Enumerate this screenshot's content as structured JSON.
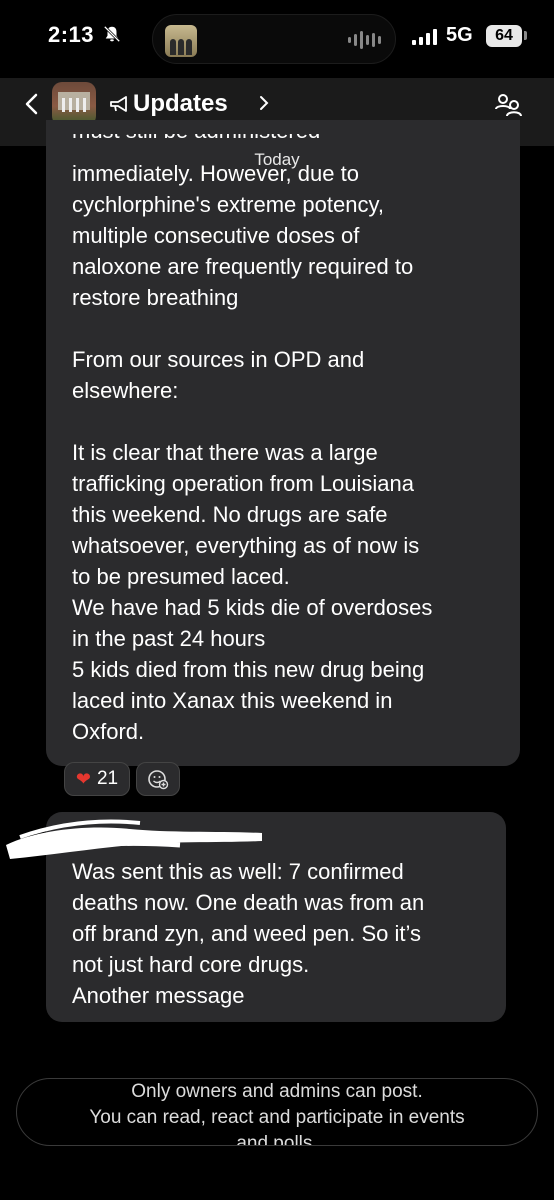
{
  "status_bar": {
    "time": "2:13",
    "network": "5G",
    "battery": "64"
  },
  "header": {
    "title": "Updates",
    "icons": [
      "back-chevron-icon",
      "megaphone-icon",
      "title-chevron-icon",
      "members-icon"
    ]
  },
  "date_divider": "Today",
  "messages": [
    {
      "cutoff_line": "must still be administered",
      "text": "immediately. However, due to\ncychlorphine's extreme potency,\nmultiple consecutive doses of\nnaloxone are frequently required to\nrestore breathing\n\nFrom our sources in OPD and\nelsewhere:\n\nIt is clear that there was a large\ntrafficking operation from Louisiana\nthis weekend. No drugs are safe\nwhatsoever, everything as of now is\nto be presumed laced.\nWe have had 5 kids die of overdoses\nin the past 24 hours\n5 kids died from this new drug being\nlaced into Xanax this weekend in\nOxford.",
      "reaction": {
        "emoji": "❤️",
        "count": "21"
      }
    },
    {
      "text": "Was sent this as well: 7 confirmed\ndeaths now. One death was from an\noff brand zyn, and weed pen. So it’s\nnot just hard core drugs.\nAnother message"
    }
  ],
  "footer_notice": {
    "line1": "Only owners and admins can post.",
    "line2": "You can read, react and participate in events",
    "line3": "and polls."
  },
  "colors": {
    "background": "#000000",
    "header": "#1b1b1b",
    "bubble": "#2b2b2d",
    "heart": "#e5372f"
  }
}
